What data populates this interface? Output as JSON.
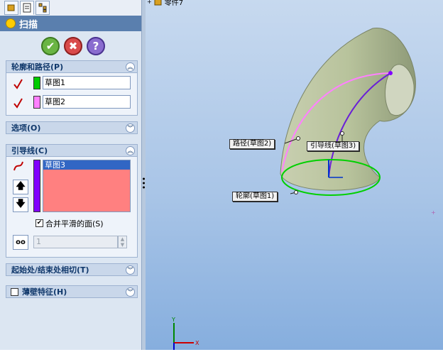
{
  "feature_title": "扫描",
  "actions": {
    "ok": "✔",
    "cancel": "✖",
    "help": "?"
  },
  "groups": {
    "profile_path": {
      "header": "轮廓和路径(P)",
      "profile_value": "草图1",
      "path_value": "草图2",
      "profile_color": "#00cc00",
      "path_color": "#ff80ff"
    },
    "options": {
      "header": "选项(O)"
    },
    "guide_curves": {
      "header": "引导线(C)",
      "selected_item": "草图3",
      "list_color": "#ff8080",
      "swatch_color": "#8000ff",
      "merge_label": "合并平滑的面(S)",
      "merge_checked": true,
      "stepper_value": "1"
    },
    "start_end": {
      "header": "起始处/结束处相切(T)"
    },
    "thin": {
      "header": "薄壁特征(H)"
    }
  },
  "viewport": {
    "tree_item": "零件7",
    "callouts": {
      "path": "路径(草图2)",
      "guide": "引导线(草图3)",
      "profile": "轮廓(草图1)"
    }
  }
}
